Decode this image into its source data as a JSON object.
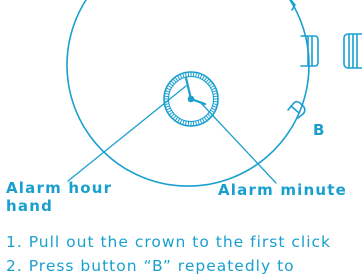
{
  "figure": {
    "button_label": "B",
    "hour_hand_label": "Alarm hour\nhand",
    "minute_hand_label": "Alarm minute",
    "steps": [
      "1.  Pull out the crown to the first click",
      "2.  Press button “B” repeatedly to"
    ]
  },
  "colors": {
    "line": "#1aa0cf",
    "text": "#1aa0cf",
    "background": "#ffffff"
  }
}
